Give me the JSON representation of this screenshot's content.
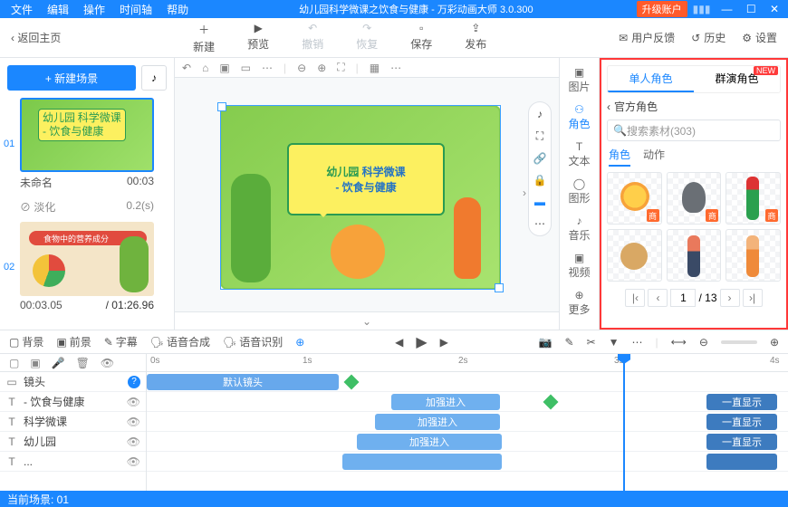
{
  "titlebar": {
    "menus": [
      "文件",
      "编辑",
      "操作",
      "时间轴",
      "帮助"
    ],
    "doc_title": "幼儿园科学微课之饮食与健康 - 万彩动画大师 3.0.300",
    "upgrade": "升级账户"
  },
  "toolbar": {
    "back": "返回主页",
    "new": "新建",
    "preview": "预览",
    "undo": "撤销",
    "redo": "恢复",
    "save": "保存",
    "publish": "发布",
    "feedback": "用户反馈",
    "history": "历史",
    "settings": "设置"
  },
  "left": {
    "new_scene": "+  新建场景",
    "scene1": {
      "num": "01",
      "title_a": "幼儿园",
      "title_b": "科学微课",
      "title_c": "- 饮食与健康",
      "name": "未命名",
      "dur": "00:03"
    },
    "transition": {
      "name": "淡化",
      "dur": "0.2(s)"
    },
    "scene2": {
      "num": "02",
      "bar": "食物中的营养成分",
      "t1": "00:03.05",
      "t2": "01:26.96"
    }
  },
  "artboard": {
    "line1": "幼儿园",
    "line2": "科学微课",
    "line3": "- 饮食与健康"
  },
  "side_tabs": {
    "pic": "图片",
    "role": "角色",
    "text": "文本",
    "shape": "图形",
    "music": "音乐",
    "video": "视频",
    "more": "更多"
  },
  "right": {
    "tab_single": "单人角色",
    "tab_group": "群演角色",
    "new": "NEW",
    "crumb": "官方角色",
    "search": "搜索素材(303)",
    "sub_role": "角色",
    "sub_action": "动作",
    "badge": "商",
    "page": "1",
    "total": "/ 13"
  },
  "tl_toolbar": {
    "bg": "背景",
    "fg": "前景",
    "subtitle": "字幕",
    "tts": "语音合成",
    "asr": "语音识别"
  },
  "ruler": {
    "s0": "0s",
    "s1": "1s",
    "s2": "2s",
    "s3": "3s",
    "s4": "4s"
  },
  "tracks": {
    "camera": "镜头",
    "default_cam": "默认镜头",
    "t1": "- 饮食与健康",
    "t2": "科学微课",
    "t3": "幼儿园",
    "enter": "加强进入",
    "always": "一直显示"
  },
  "status": "当前场景: 01"
}
